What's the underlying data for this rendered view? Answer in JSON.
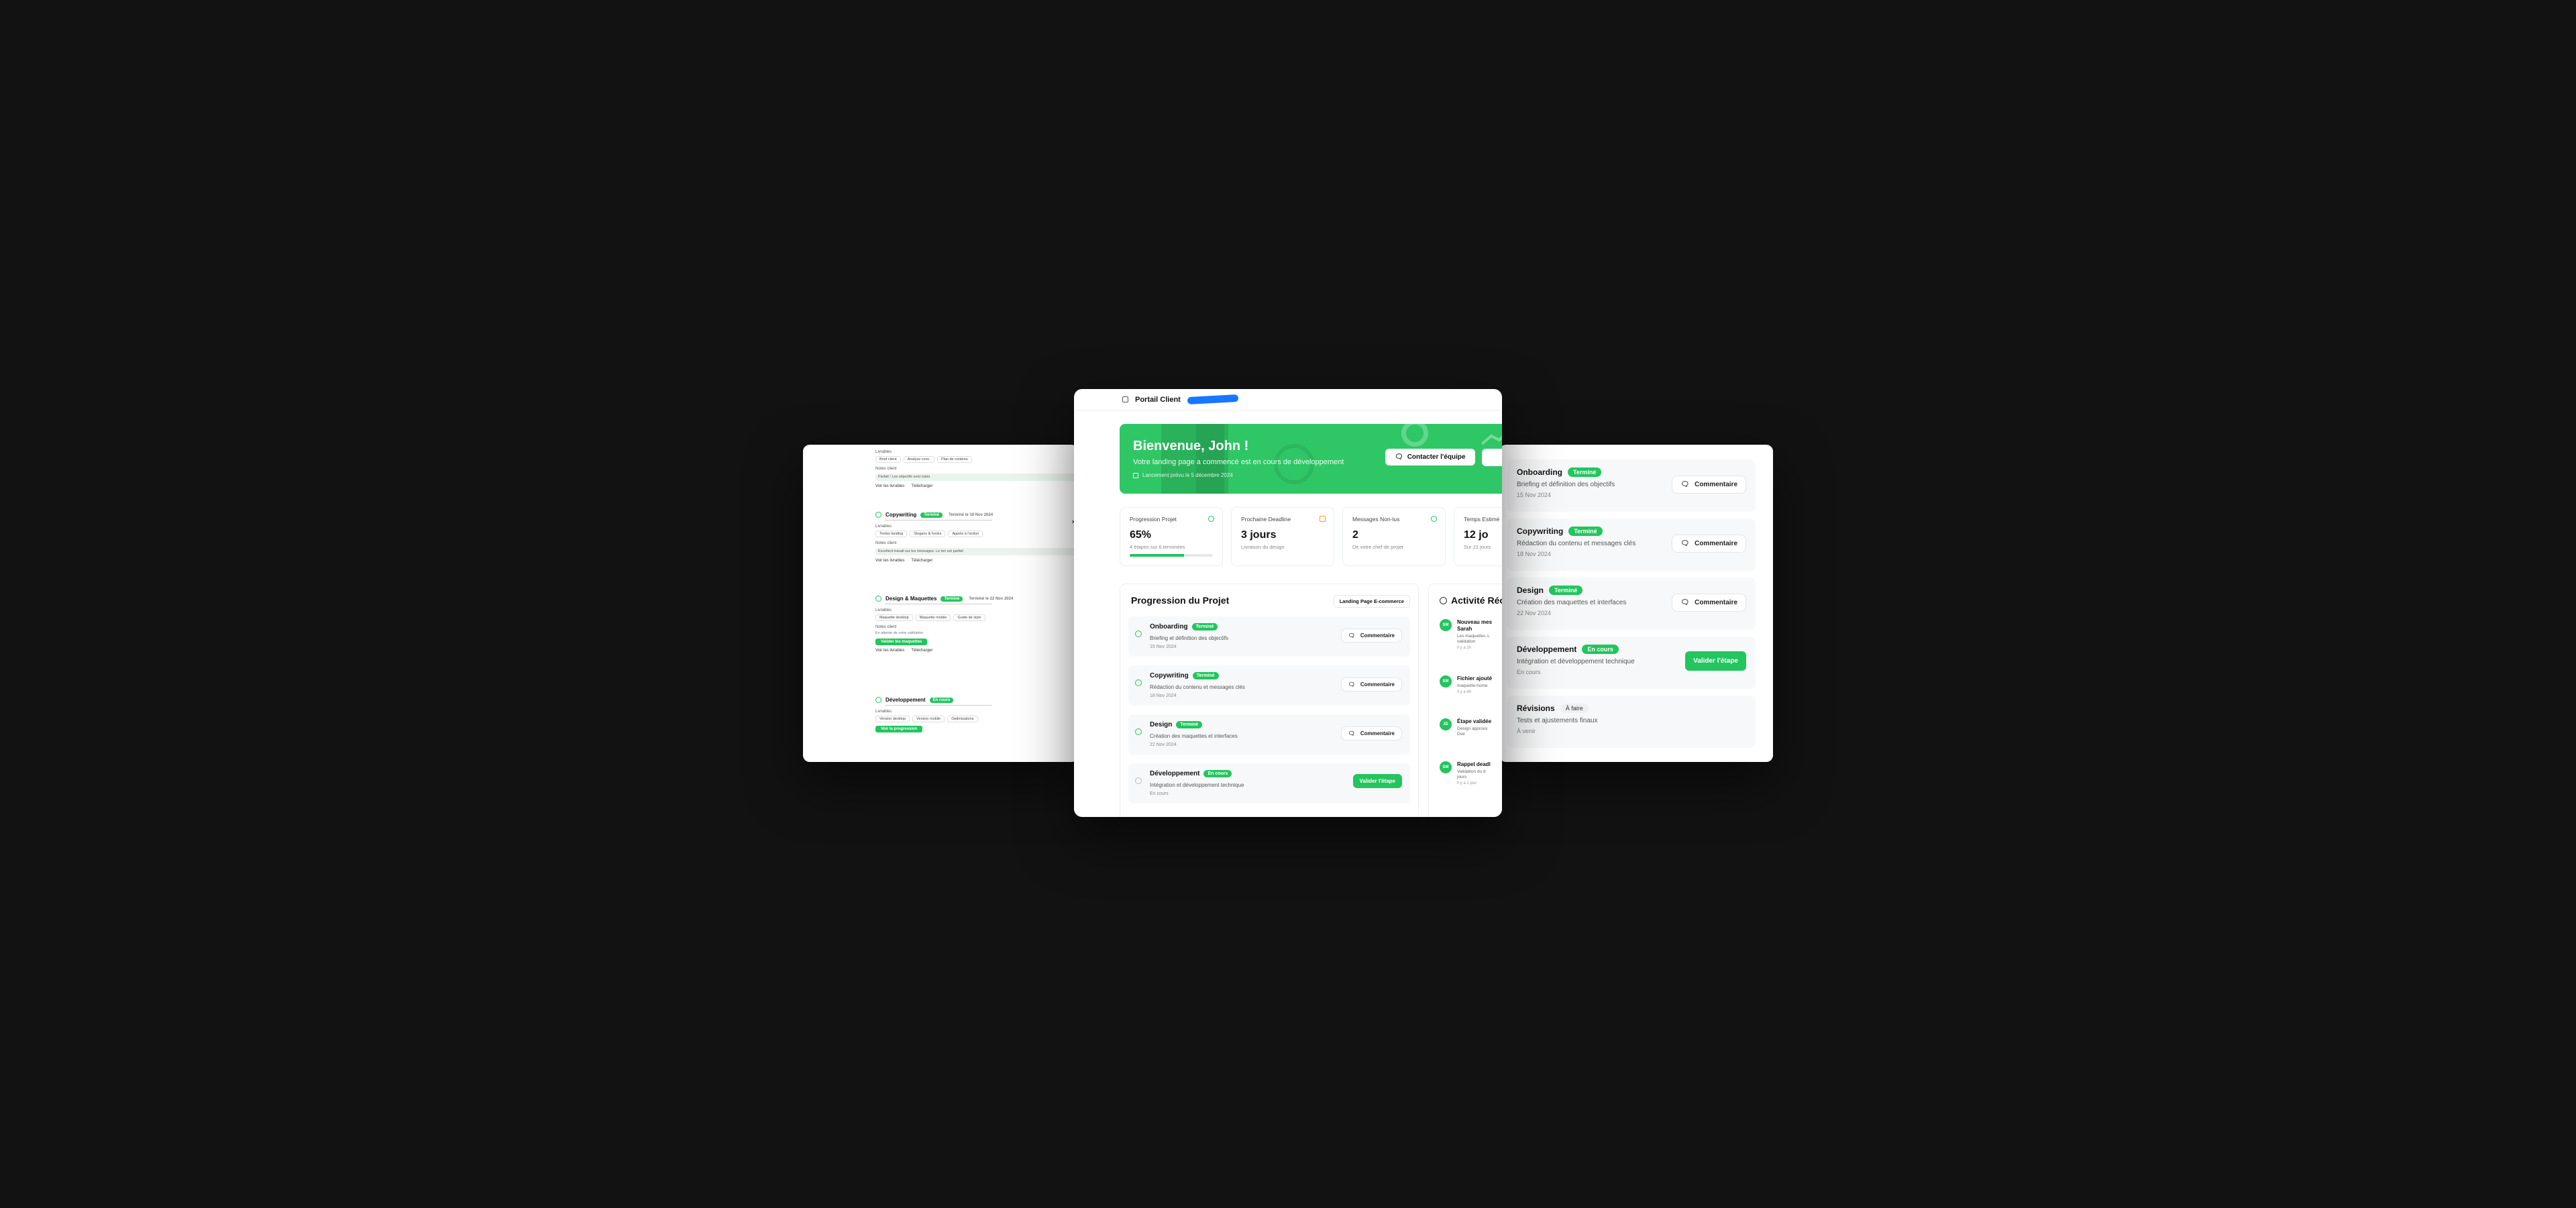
{
  "app": {
    "title": "Portail Client"
  },
  "hero": {
    "greeting": "Bienvenue, John !",
    "subtitle": "Votre landing page a commencé est en cours de développement",
    "meta": "Lancement prévu le 5 décembre 2024",
    "contact_button": "Contacter l'équipe"
  },
  "stats": [
    {
      "label": "Progression Projet",
      "value": "65%",
      "hint": "4 étapes sur 6 terminées",
      "progress": 0.65
    },
    {
      "label": "Prochaine Deadline",
      "value": "3 jours",
      "hint": "Livraison du design"
    },
    {
      "label": "Messages Non-lus",
      "value": "2",
      "hint": "De votre chef de projet"
    },
    {
      "label": "Temps Estimé",
      "value": "12 jo",
      "hint": "Sur 21 jours"
    }
  ],
  "progress": {
    "title": "Progression du Projet",
    "project_select": "Landing Page E-commerce",
    "steps": [
      {
        "name": "Onboarding",
        "status": "Terminé",
        "desc": "Briefing et définition des objectifs",
        "date": "15 Nov 2024",
        "action": "Commentaire"
      },
      {
        "name": "Copywriting",
        "status": "Terminé",
        "desc": "Rédaction du contenu et messages clés",
        "date": "18 Nov 2024",
        "action": "Commentaire"
      },
      {
        "name": "Design",
        "status": "Terminé",
        "desc": "Création des maquettes et interfaces",
        "date": "22 Nov 2024",
        "action": "Commentaire"
      },
      {
        "name": "Développement",
        "status": "En cours",
        "desc": "Intégration et développement technique",
        "date": "En cours",
        "action": "Valider l'étape"
      }
    ]
  },
  "activity": {
    "title": "Activité Réc",
    "items": [
      {
        "avatar": "SM",
        "title": "Nouveau mes",
        "title2": "Sarah",
        "desc": "Les maquettes s",
        "desc2": "validation",
        "time": "Il y a 2h"
      },
      {
        "avatar": "SM",
        "title": "Fichier ajouté",
        "desc": "maquette-home",
        "time": "Il y a 4h"
      },
      {
        "avatar": "JD",
        "title": "Étape validée",
        "desc": "Design approuv",
        "desc2": "Doe",
        "time": ""
      },
      {
        "avatar": "SM",
        "title": "Rappel deadl",
        "desc": "Validation du d",
        "desc2": "jours",
        "time": "Il y a 1 jour"
      }
    ]
  },
  "right_panel": {
    "steps": [
      {
        "name": "Onboarding",
        "status": "Terminé",
        "desc": "Briefing et définition des objectifs",
        "date": "15 Nov 2024",
        "action": "Commentaire"
      },
      {
        "name": "Copywriting",
        "status": "Terminé",
        "desc": "Rédaction du contenu et messages clés",
        "date": "18 Nov 2024",
        "action": "Commentaire"
      },
      {
        "name": "Design",
        "status": "Terminé",
        "desc": "Création des maquettes et interfaces",
        "date": "22 Nov 2024",
        "action": "Commentaire"
      },
      {
        "name": "Développement",
        "status": "En cours",
        "desc": "Intégration et développement technique",
        "date": "En cours",
        "action": "Valider l'étape"
      },
      {
        "name": "Révisions",
        "status": "À faire",
        "desc": "Tests et ajustements finaux",
        "date": "À venir",
        "action": ""
      }
    ]
  },
  "left_panel": {
    "close": "×",
    "sections": [
      {
        "name": "",
        "status": "",
        "label1": "Livrables",
        "chips": [
          "Brief client",
          "Analyse conc.",
          "Plan de contenu"
        ],
        "label2": "Notes client",
        "note": "Parfait ! Les objectifs sont clairs",
        "actions": [
          "Voir les livrables",
          "Télécharger"
        ]
      },
      {
        "name": "Copywriting",
        "status": "Terminé",
        "sub": "Terminé le 18 Nov 2024",
        "label1": "Livrables",
        "chips": [
          "Textes landing",
          "Slogans & hooks",
          "Appels à l'action"
        ],
        "label2": "Notes client",
        "note": "Excellent travail sur les messages. Le ton est parfait",
        "actions": [
          "Voir les livrables",
          "Télécharger"
        ]
      },
      {
        "name": "Design & Maquettes",
        "status": "Terminé",
        "sub": "Terminé le 22 Nov 2024",
        "label1": "Livrables",
        "chips": [
          "Maquette desktop",
          "Maquette mobile",
          "Guide de style"
        ],
        "label2": "Notes client",
        "note": "En attente de votre validation",
        "green": "Valider les maquettes",
        "actions": [
          "Voir les livrables",
          "Télécharger"
        ]
      },
      {
        "name": "Développement",
        "status": "En cours",
        "label1": "Livrables",
        "chips": [
          "Version desktop",
          "Version mobile",
          "Optimisations"
        ],
        "green": "Voir la progression"
      }
    ]
  }
}
